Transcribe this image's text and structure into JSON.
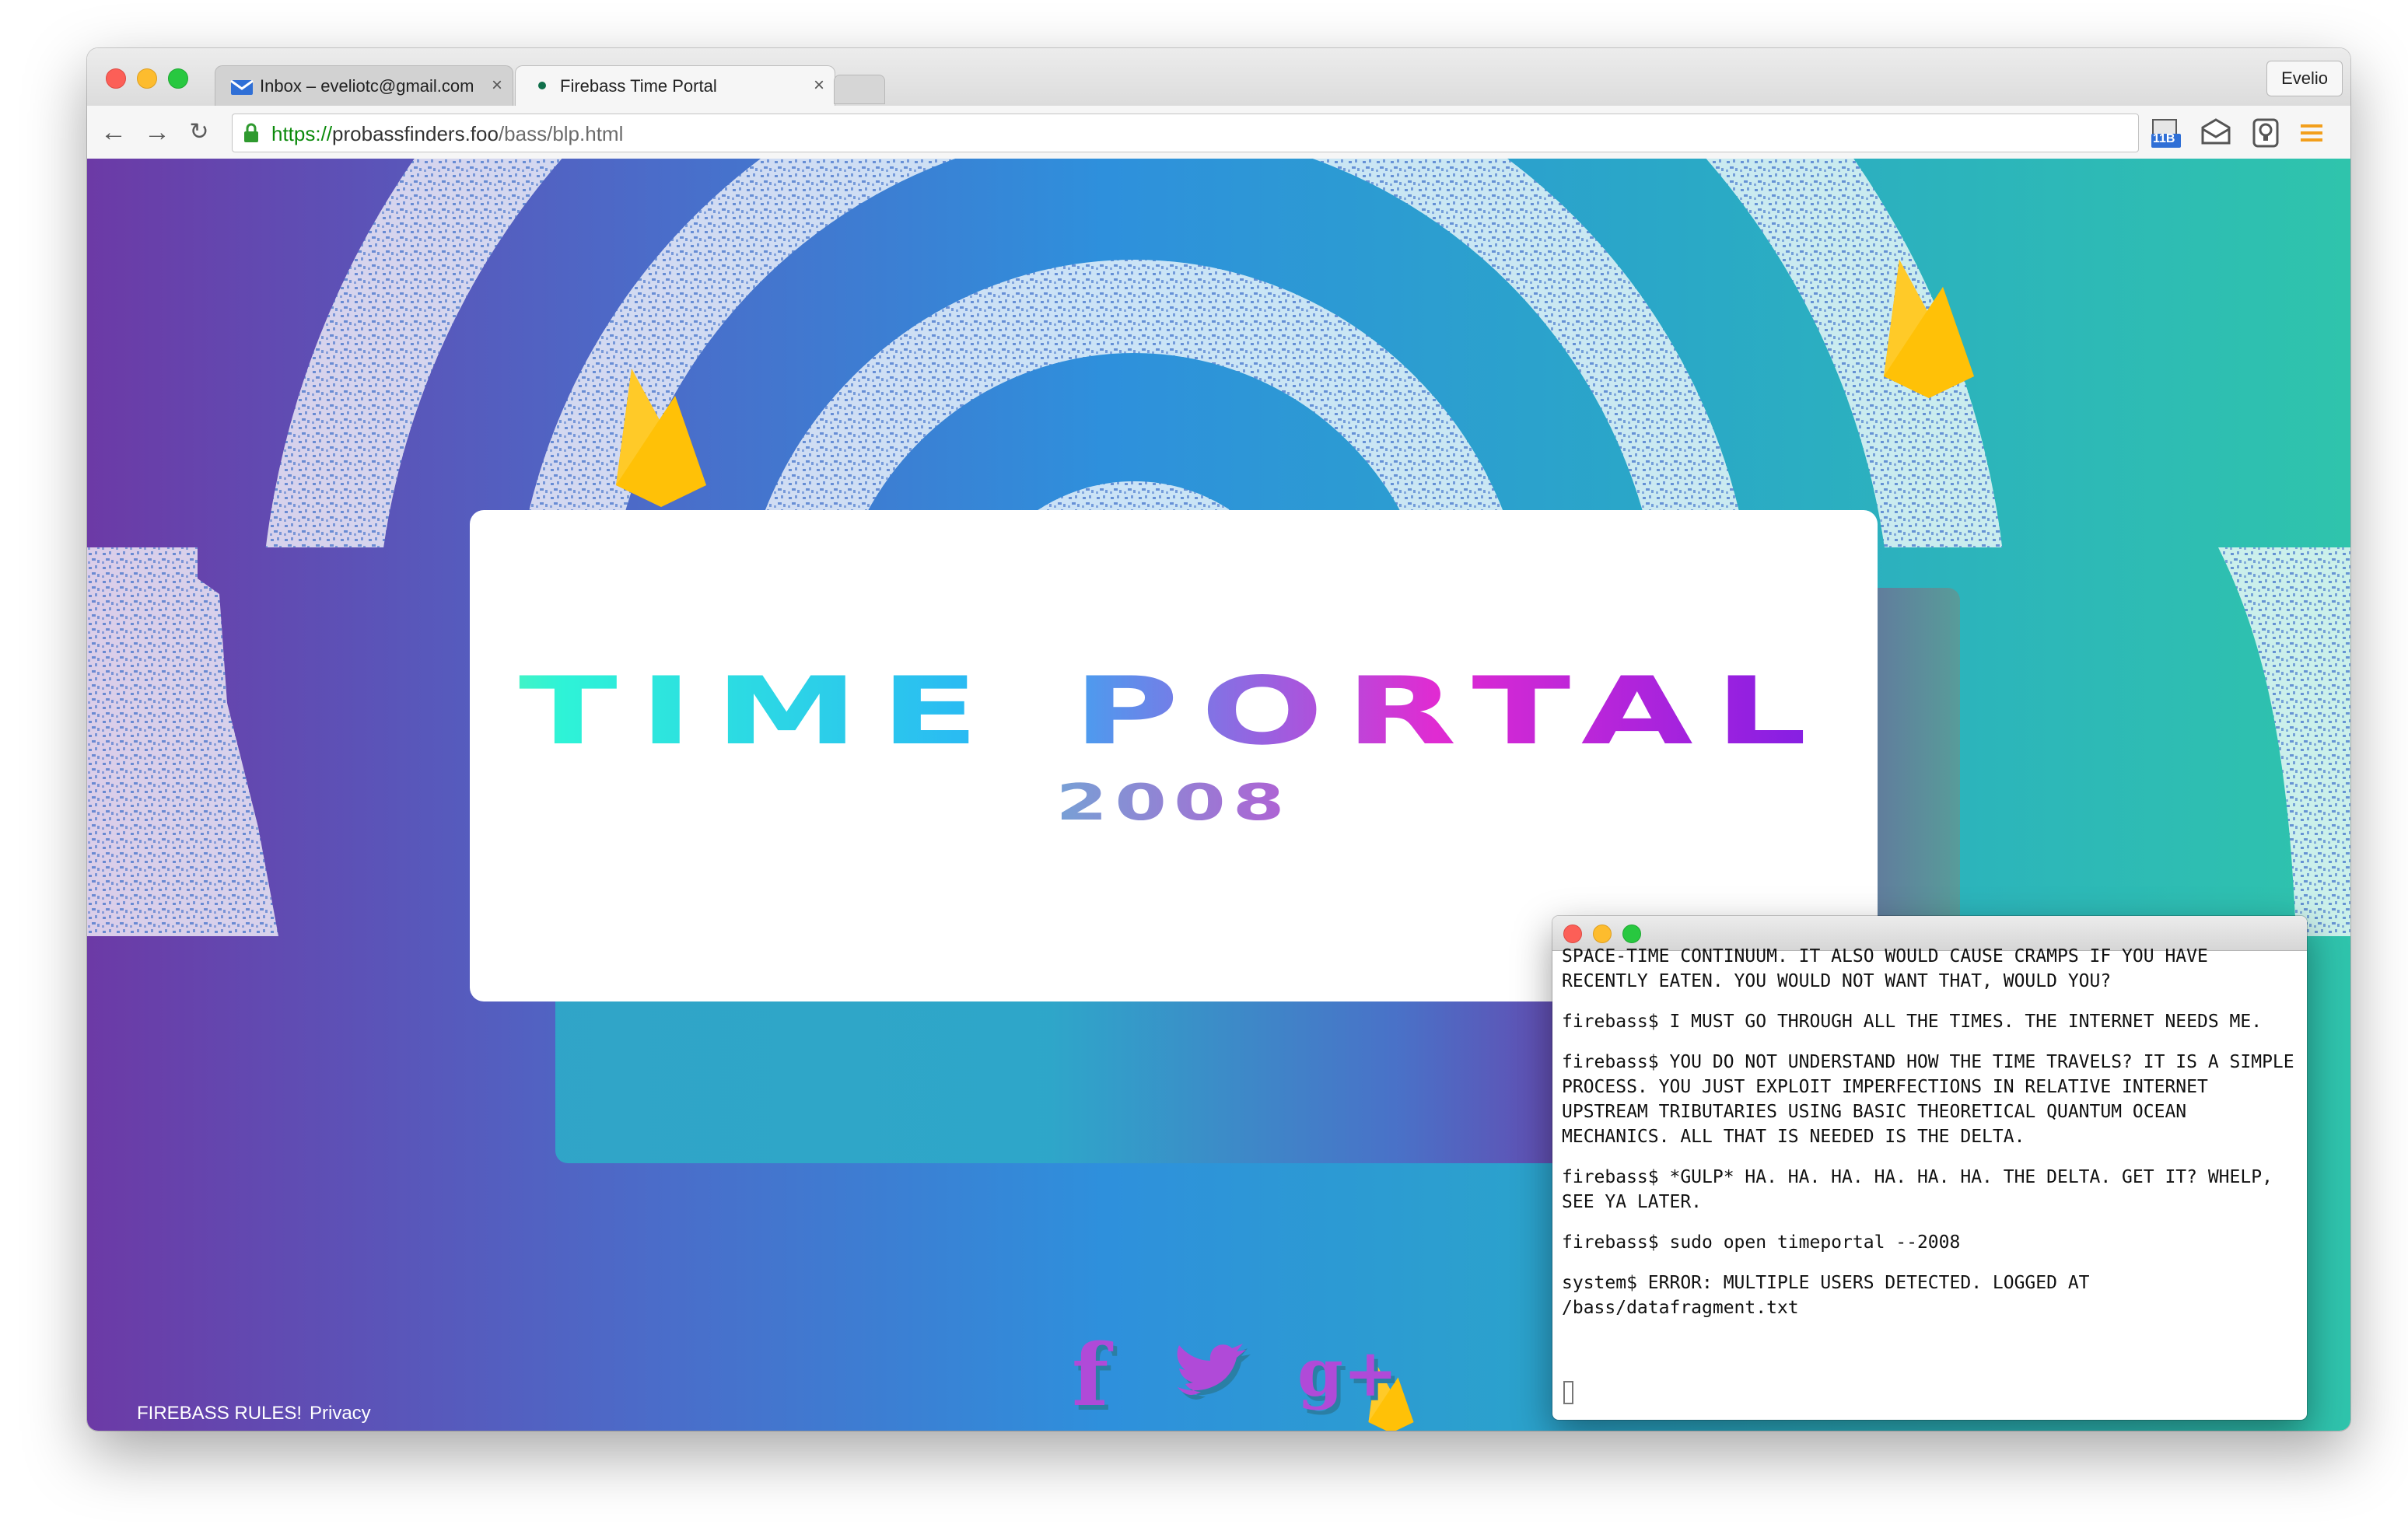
{
  "browser": {
    "tabs": [
      {
        "label": "Inbox – eveliotc@gmail.com",
        "active": false,
        "icon": "gmail-envelope-icon"
      },
      {
        "label": "Firebass Time Portal",
        "active": true,
        "icon": "green-dot-icon"
      }
    ],
    "profile_name": "Evelio",
    "url": {
      "scheme": "https://",
      "host": "probassfinders.foo",
      "path": "/bass/blp.html"
    },
    "extensions": [
      {
        "name": "calendar-extension-icon",
        "badge": "11B"
      },
      {
        "name": "mail-extension-icon"
      },
      {
        "name": "lightbulb-extension-icon"
      },
      {
        "name": "menu-icon"
      }
    ]
  },
  "page": {
    "title": "TIME PORTAL",
    "year": "2008",
    "footer": {
      "left_link": "FIREBASS RULES!",
      "privacy_link": "Privacy"
    },
    "social": [
      {
        "name": "facebook-icon",
        "glyph": "f"
      },
      {
        "name": "twitter-icon",
        "glyph": "twitter bird"
      },
      {
        "name": "google-plus-icon",
        "glyph": "g+"
      }
    ],
    "colors": {
      "bg_left": "#6c3aa6",
      "bg_mid": "#2e90dc",
      "bg_right": "#2fc4ac",
      "flame": "#ffc928",
      "social": "#b04ad8"
    }
  },
  "terminal": {
    "lines": [
      "SPACE-TIME CONTINUUM. IT ALSO WOULD CAUSE CRAMPS IF YOU HAVE RECENTLY EATEN. YOU WOULD NOT WANT THAT, WOULD YOU?",
      "firebass$ I MUST GO THROUGH ALL THE TIMES. THE INTERNET NEEDS ME.",
      "firebass$ YOU DO NOT UNDERSTAND HOW THE TIME TRAVELS? IT IS A SIMPLE PROCESS. YOU JUST EXPLOIT IMPERFECTIONS IN RELATIVE INTERNET UPSTREAM TRIBUTARIES USING BASIC THEORETICAL QUANTUM OCEAN MECHANICS. ALL THAT IS NEEDED IS THE DELTA.",
      "firebass$ *GULP* HA. HA. HA. HA. HA. HA. THE DELTA. GET IT? WHELP, SEE YA LATER.",
      "firebass$ sudo open timeportal --2008",
      "system$ ERROR: MULTIPLE USERS DETECTED. LOGGED AT /bass/datafragment.txt"
    ]
  }
}
